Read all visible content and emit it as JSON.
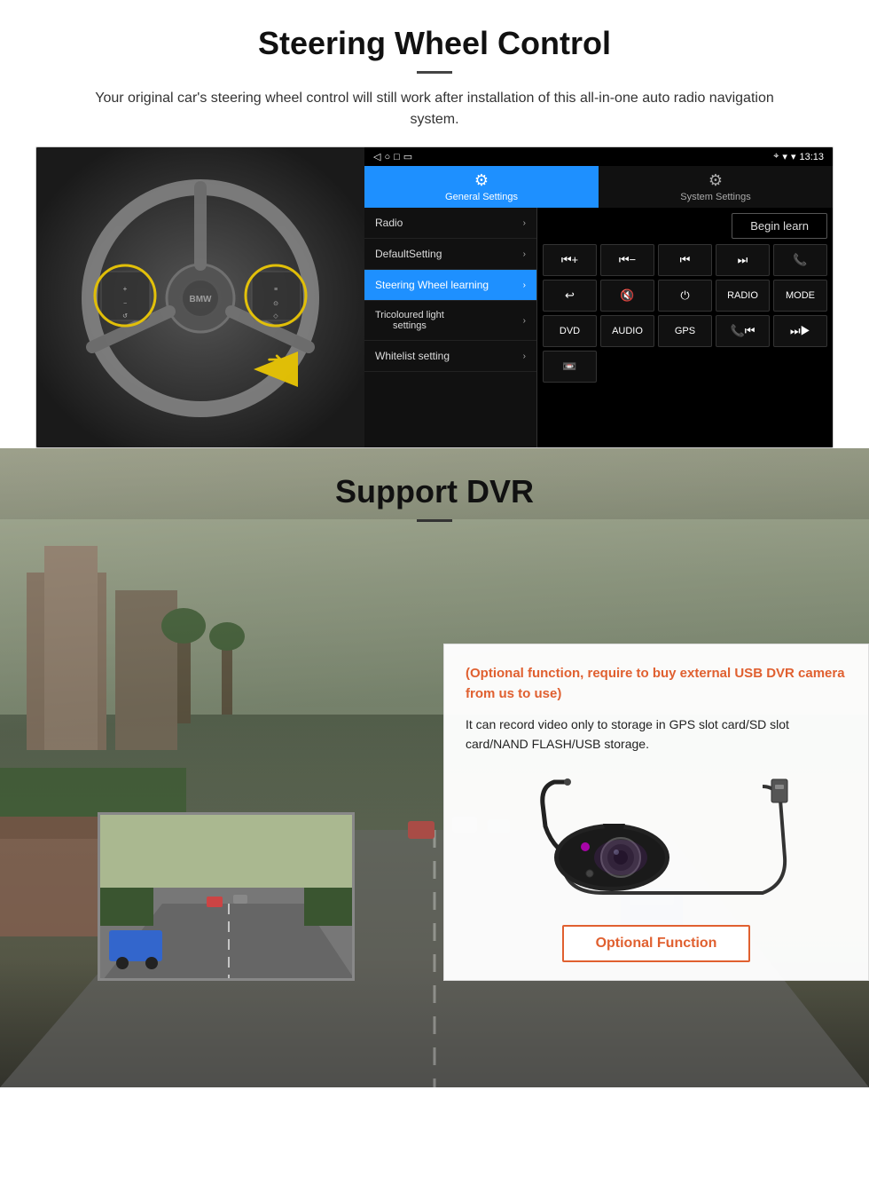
{
  "steering": {
    "title": "Steering Wheel Control",
    "subtitle": "Your original car's steering wheel control will still work after installation of this all-in-one auto radio navigation system.",
    "statusbar": {
      "time": "13:13",
      "signal": "▼",
      "wifi": "▾"
    },
    "tabs": {
      "general": {
        "label": "General Settings",
        "icon": "⚙"
      },
      "system": {
        "label": "System Settings",
        "icon": "⚙"
      }
    },
    "menu": [
      {
        "label": "Radio",
        "active": false
      },
      {
        "label": "DefaultSetting",
        "active": false
      },
      {
        "label": "Steering Wheel learning",
        "active": true
      },
      {
        "label": "Tricoloured light settings",
        "active": false
      },
      {
        "label": "Whitelist setting",
        "active": false
      }
    ],
    "begin_learn_label": "Begin learn",
    "controls": [
      "⏮+",
      "⏮−",
      "⏮⏮",
      "⏭⏭",
      "📞",
      "↩",
      "🔇",
      "⏻",
      "RADIO",
      "MODE",
      "DVD",
      "AUDIO",
      "GPS",
      "📞⏮",
      "⏭⏭"
    ],
    "controls_row3": [
      "📼"
    ]
  },
  "dvr": {
    "title": "Support DVR",
    "optional_text": "(Optional function, require to buy external USB DVR camera from us to use)",
    "description": "It can record video only to storage in GPS slot card/SD slot card/NAND FLASH/USB storage.",
    "optional_button_label": "Optional Function"
  }
}
